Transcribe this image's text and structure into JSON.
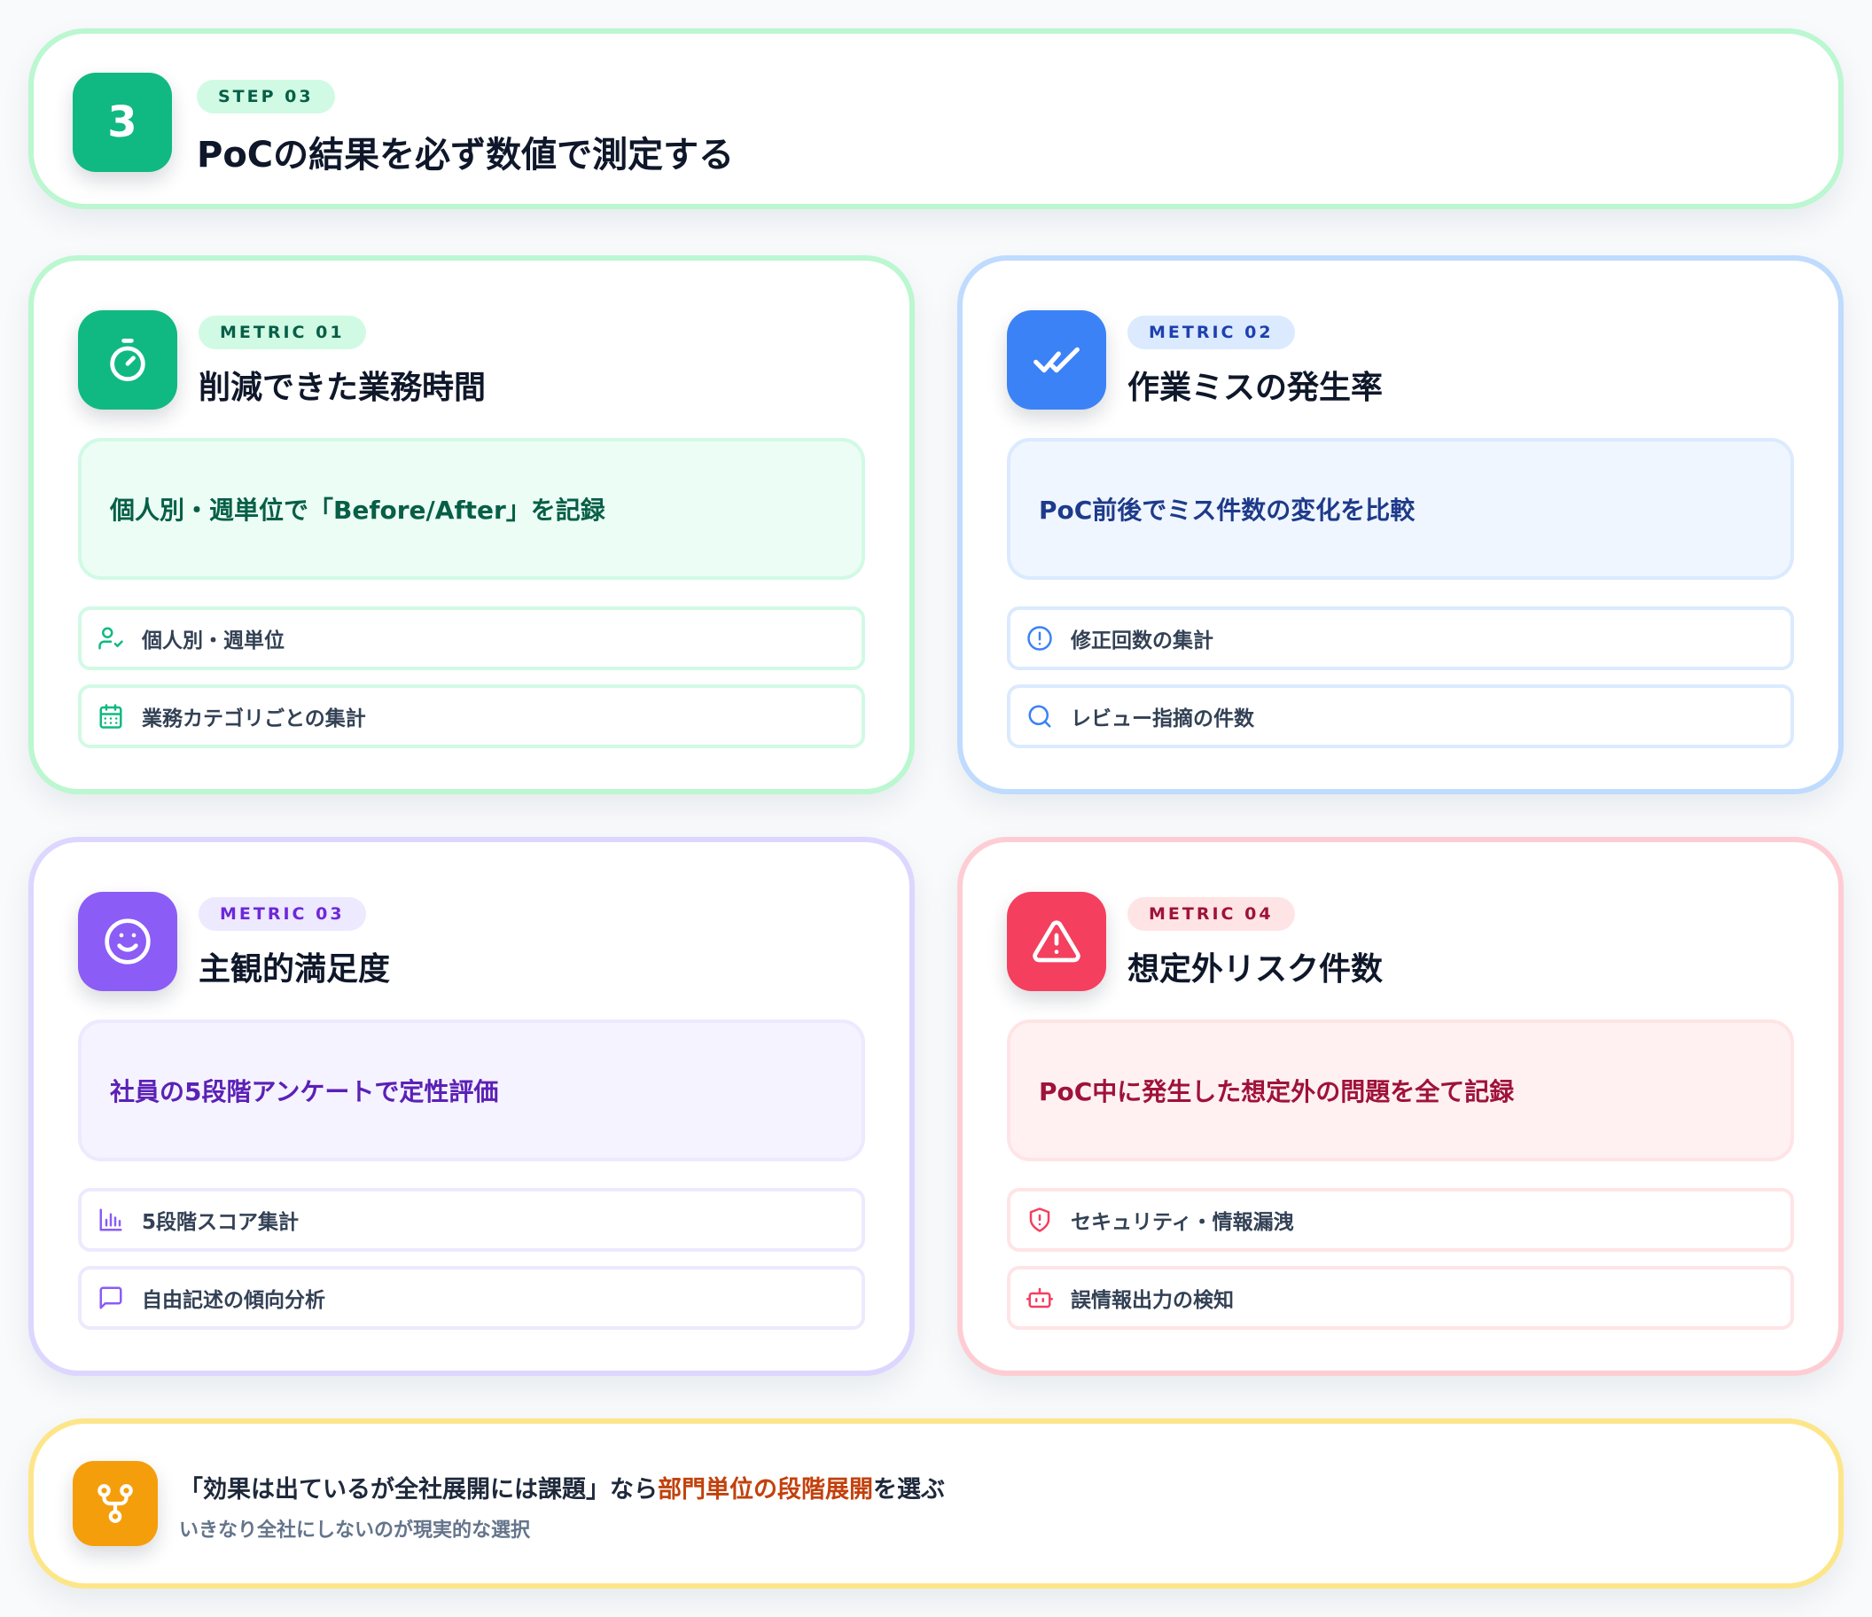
{
  "colors": {
    "green": "#10b981",
    "blue": "#3b82f6",
    "purple": "#8b5cf6",
    "red": "#f43f5e",
    "amber": "#f59e0b",
    "accent_text": "#c2410c"
  },
  "header": {
    "number": "3",
    "step_label": "STEP 03",
    "title": "PoCの結果を必ず数値で測定する"
  },
  "metrics": [
    {
      "pill": "METRIC 01",
      "title": "削減できた業務時間",
      "icon": "stopwatch-icon",
      "highlight": "個人別・週単位で「Before/After」を記録",
      "items": [
        {
          "icon": "user-check-icon",
          "label": "個人別・週単位"
        },
        {
          "icon": "calendar-icon",
          "label": "業務カテゴリごとの集計"
        }
      ]
    },
    {
      "pill": "METRIC 02",
      "title": "作業ミスの発生率",
      "icon": "double-check-icon",
      "highlight": "PoC前後でミス件数の変化を比較",
      "items": [
        {
          "icon": "alert-circle-icon",
          "label": "修正回数の集計"
        },
        {
          "icon": "search-icon",
          "label": "レビュー指摘の件数"
        }
      ]
    },
    {
      "pill": "METRIC 03",
      "title": "主観的満足度",
      "icon": "smile-icon",
      "highlight": "社員の5段階アンケートで定性評価",
      "items": [
        {
          "icon": "bar-chart-icon",
          "label": "5段階スコア集計"
        },
        {
          "icon": "message-icon",
          "label": "自由記述の傾向分析"
        }
      ]
    },
    {
      "pill": "METRIC 04",
      "title": "想定外リスク件数",
      "icon": "warning-icon",
      "highlight": "PoC中に発生した想定外の問題を全て記録",
      "items": [
        {
          "icon": "shield-alert-icon",
          "label": "セキュリティ・情報漏洩"
        },
        {
          "icon": "bot-icon",
          "label": "誤情報出力の検知"
        }
      ]
    }
  ],
  "footer": {
    "icon": "git-fork-icon",
    "text_before": "「効果は出ているが全社展開には課題」なら",
    "text_emphasis": "部門単位の段階展開",
    "text_after": "を選ぶ",
    "subtext": "いきなり全社にしないのが現実的な選択"
  }
}
